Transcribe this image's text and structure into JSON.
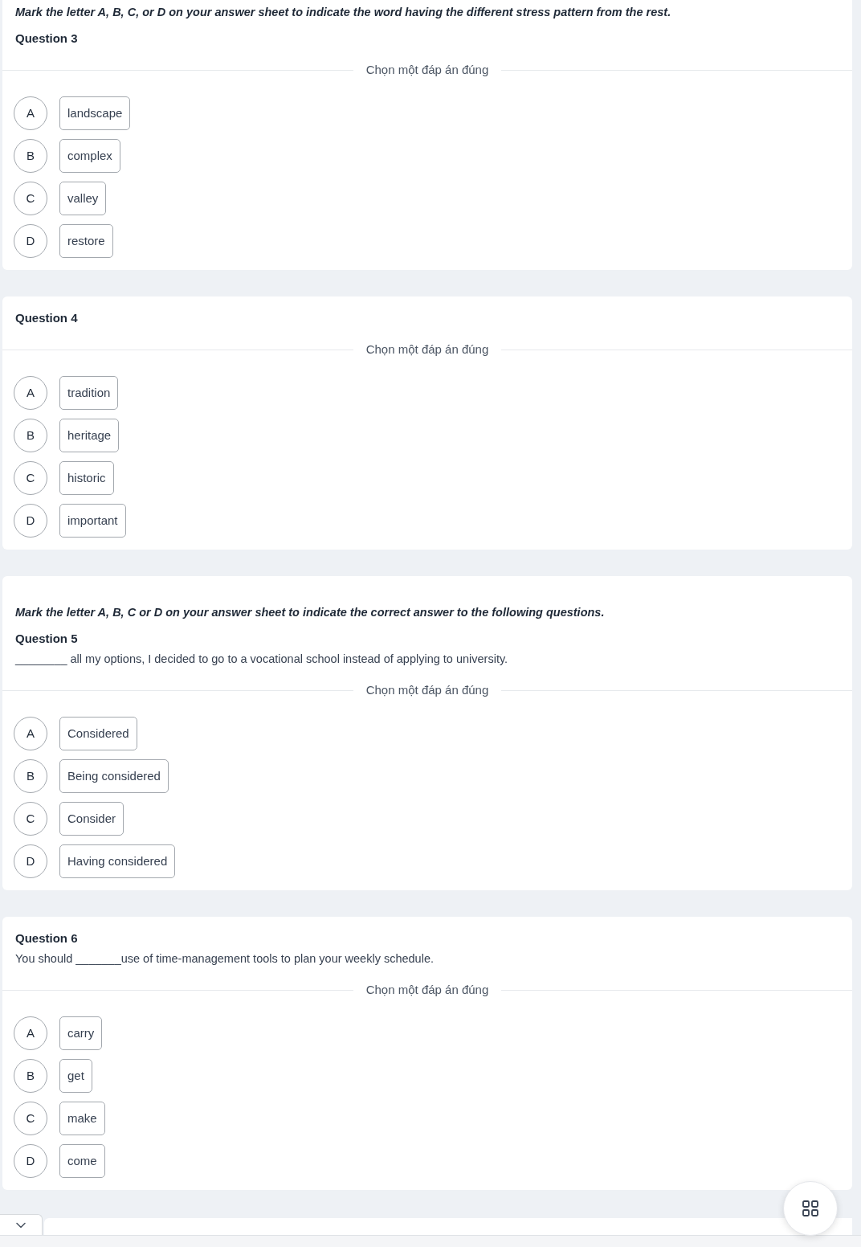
{
  "cards": [
    {
      "instruction": "Mark the letter A, B, C, or D on your answer sheet to indicate the word having the different stress pattern from the rest.",
      "title": "Question 3",
      "choice_label": "Chọn một đáp án đúng",
      "options": [
        {
          "letter": "A",
          "text": "landscape",
          "selected": false
        },
        {
          "letter": "B",
          "text": "complex",
          "selected": false
        },
        {
          "letter": "C",
          "text": "valley",
          "selected": false
        },
        {
          "letter": "D",
          "text": "restore",
          "selected": false
        }
      ]
    },
    {
      "title": "Question 4",
      "choice_label": "Chọn một đáp án đúng",
      "options": [
        {
          "letter": "A",
          "text": "tradition",
          "selected": false
        },
        {
          "letter": "B",
          "text": "heritage",
          "selected": false
        },
        {
          "letter": "C",
          "text": "historic",
          "selected": false
        },
        {
          "letter": "D",
          "text": "important",
          "selected": false
        }
      ]
    },
    {
      "instruction": "Mark the letter A, B, C or D on your answer sheet to indicate the correct answer to the following questions.",
      "title": "Question 5",
      "prompt": "________ all my options, I decided to go to a vocational school instead of applying to university.",
      "choice_label": "Chọn một đáp án đúng",
      "options": [
        {
          "letter": "A",
          "text": "Considered",
          "selected": false
        },
        {
          "letter": "B",
          "text": "Being considered",
          "selected": false
        },
        {
          "letter": "C",
          "text": "Consider",
          "selected": false
        },
        {
          "letter": "D",
          "text": "Having considered",
          "selected": false
        }
      ]
    },
    {
      "title": "Question 6",
      "prompt": "You should _______use of time-management tools to plan your weekly schedule.",
      "choice_label": "Chọn một đáp án đúng",
      "options": [
        {
          "letter": "A",
          "text": "carry",
          "selected": false
        },
        {
          "letter": "B",
          "text": "get",
          "selected": false
        },
        {
          "letter": "C",
          "text": "make",
          "selected": false
        },
        {
          "letter": "D",
          "text": "come",
          "selected": false
        }
      ]
    }
  ]
}
